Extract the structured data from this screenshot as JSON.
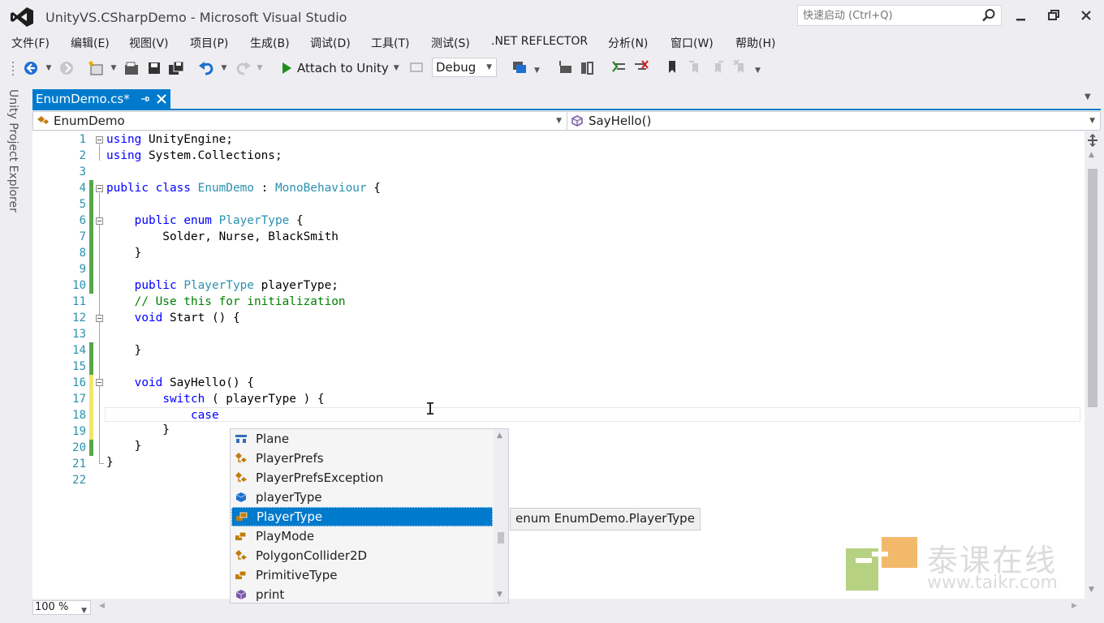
{
  "window": {
    "title": "UnityVS.CSharpDemo - Microsoft Visual Studio",
    "quick_launch_placeholder": "快速启动 (Ctrl+Q)"
  },
  "menu": [
    "文件(F)",
    "编辑(E)",
    "视图(V)",
    "项目(P)",
    "生成(B)",
    "调试(D)",
    "工具(T)",
    "测试(S)",
    ".NET REFLECTOR",
    "分析(N)",
    "窗口(W)",
    "帮助(H)"
  ],
  "toolbar": {
    "attach_label": "Attach to Unity",
    "configuration": "Debug"
  },
  "side_panel": {
    "label": "Unity Project Explorer"
  },
  "tab": {
    "title": "EnumDemo.cs*"
  },
  "navbar": {
    "class_name": "EnumDemo",
    "member_name": "SayHello()"
  },
  "editor": {
    "line_numbers": [
      "1",
      "2",
      "3",
      "4",
      "5",
      "6",
      "7",
      "8",
      "9",
      "10",
      "11",
      "12",
      "13",
      "14",
      "15",
      "16",
      "17",
      "18",
      "19",
      "20",
      "21",
      "22"
    ],
    "zoom": "100 %"
  },
  "completion": {
    "items": [
      {
        "label": "Plane",
        "icon": "struct-icon"
      },
      {
        "label": "PlayerPrefs",
        "icon": "class-icon"
      },
      {
        "label": "PlayerPrefsException",
        "icon": "class-icon"
      },
      {
        "label": "playerType",
        "icon": "field-icon"
      },
      {
        "label": "PlayerType",
        "icon": "enum-icon",
        "selected": true
      },
      {
        "label": "PlayMode",
        "icon": "enum-icon"
      },
      {
        "label": "PolygonCollider2D",
        "icon": "class-icon"
      },
      {
        "label": "PrimitiveType",
        "icon": "enum-icon"
      },
      {
        "label": "print",
        "icon": "method-icon"
      }
    ],
    "tooltip": "enum EnumDemo.PlayerType"
  },
  "watermark": {
    "cn": "泰课在线",
    "url": "www.taikr.com"
  },
  "colors": {
    "accent": "#007acc",
    "keyword": "#0000ff",
    "type": "#2b91af",
    "comment": "#008000",
    "change_saved": "#57a64a",
    "change_unsaved": "#f2e66a"
  }
}
